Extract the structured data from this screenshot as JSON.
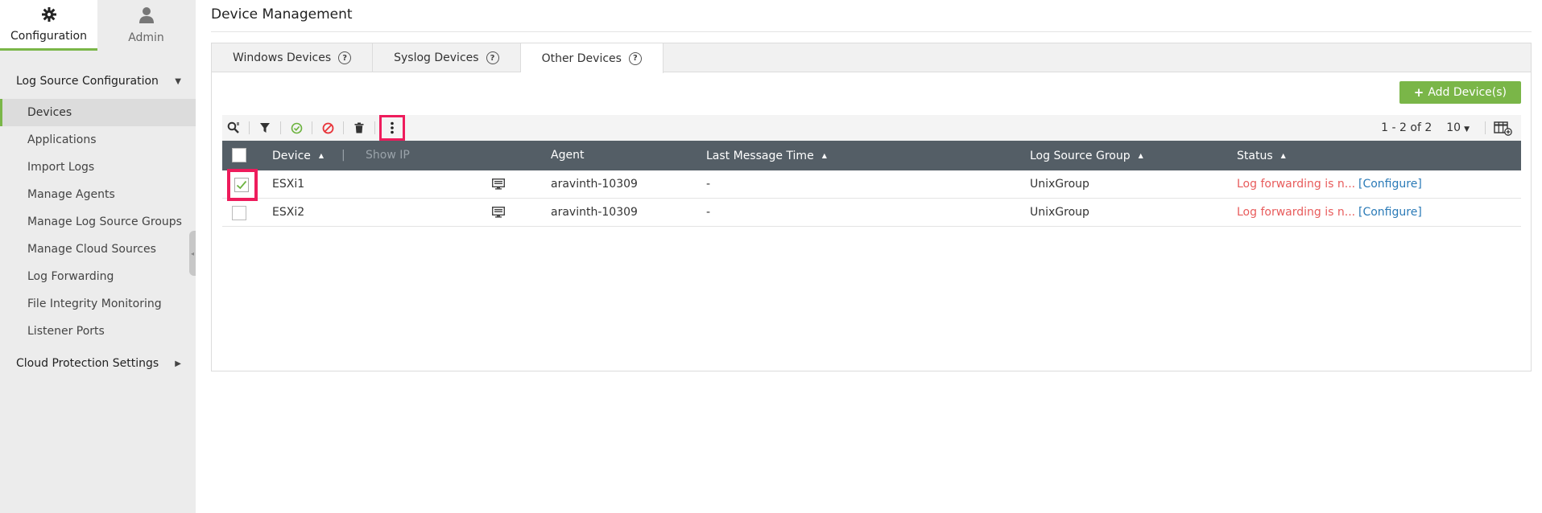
{
  "top_tabs": [
    {
      "label": "Configuration",
      "icon": "gear-icon",
      "active": true
    },
    {
      "label": "Admin",
      "icon": "user-icon",
      "active": false
    }
  ],
  "sidebar": {
    "section1": "Log Source Configuration",
    "items": [
      {
        "label": "Devices",
        "active": true
      },
      {
        "label": "Applications"
      },
      {
        "label": "Import Logs"
      },
      {
        "label": "Manage Agents"
      },
      {
        "label": "Manage Log Source Groups"
      },
      {
        "label": "Manage Cloud Sources"
      },
      {
        "label": "Log Forwarding"
      },
      {
        "label": "File Integrity Monitoring"
      },
      {
        "label": "Listener Ports"
      }
    ],
    "section2": "Cloud Protection Settings"
  },
  "page_title": "Device Management",
  "device_tabs": [
    {
      "label": "Windows Devices"
    },
    {
      "label": "Syslog Devices"
    },
    {
      "label": "Other Devices",
      "active": true
    }
  ],
  "add_button": "Add Device(s)",
  "toolbar": {
    "pagination": "1 - 2 of 2",
    "page_size": "10"
  },
  "table": {
    "headers": {
      "device": "Device",
      "divider": "|",
      "show_ip": "Show IP",
      "agent": "Agent",
      "last_message_time": "Last Message Time",
      "log_source_group": "Log Source Group",
      "status": "Status"
    },
    "rows": [
      {
        "device": "ESXi1",
        "agent": "aravinth-10309",
        "last_message_time": "-",
        "group": "UnixGroup",
        "status": "Log forwarding is n...",
        "action": "[Configure]",
        "checked": true
      },
      {
        "device": "ESXi2",
        "agent": "aravinth-10309",
        "last_message_time": "-",
        "group": "UnixGroup",
        "status": "Log forwarding is n...",
        "action": "[Configure]",
        "checked": false
      }
    ]
  },
  "colors": {
    "accent": "#7ab648",
    "header_bg": "#545e66",
    "highlight": "#ee1c5c",
    "status_error": "#e85c5c",
    "link": "#2a7ab7"
  }
}
